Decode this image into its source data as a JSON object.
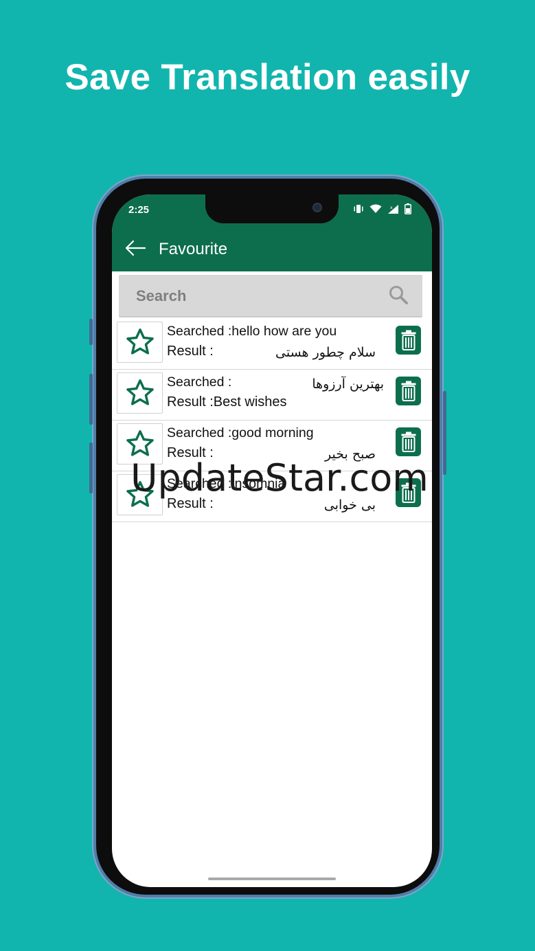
{
  "headline": "Save Translation easily",
  "status": {
    "time": "2:25"
  },
  "appbar": {
    "title": "Favourite"
  },
  "search": {
    "placeholder": "Search"
  },
  "items": [
    {
      "searched": "Searched :hello how are you",
      "result": "Result :",
      "rtl_result": "سلام چطور هستی",
      "rtl_searched": ""
    },
    {
      "searched": "Searched :",
      "result": "Result :Best wishes",
      "rtl_result": "",
      "rtl_searched": "بهترین آرزوها"
    },
    {
      "searched": "Searched :good morning",
      "result": "Result :",
      "rtl_result": "صبح بخیر",
      "rtl_searched": ""
    },
    {
      "searched": "Searched :insomnia",
      "result": "Result :",
      "rtl_result": "بی خوابی",
      "rtl_searched": ""
    }
  ],
  "watermark": "UpdateStar.com",
  "colors": {
    "background": "#12b5ae",
    "primary": "#0d6e4e",
    "phone_frame": "#4f7ea9"
  }
}
